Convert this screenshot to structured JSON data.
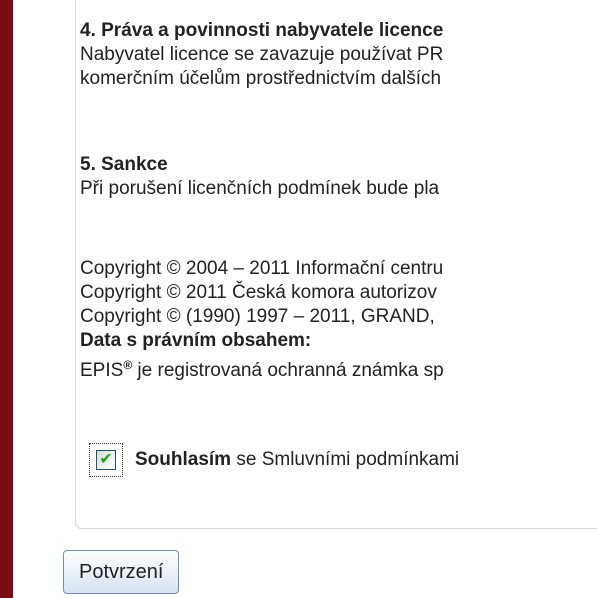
{
  "license": {
    "section4": {
      "heading": "4. Práva a povinnosti nabyvatele licence",
      "lines": [
        "Nabyvatel licence se zavazuje používat PR",
        "komerčním účelům prostřednictvím dalších"
      ]
    },
    "section5": {
      "heading": "5. Sankce",
      "lines": [
        "Při porušení licenčních podmínek bude pla"
      ]
    },
    "copyright": {
      "lines": [
        "Copyright © 2004 – 2011 Informační centru",
        "Copyright © 2011 Česká komora autorizov",
        "Copyright © (1990) 1997 – 2011, GRAND,"
      ],
      "data_heading": "Data s právním obsahem:",
      "epis_name": "EPIS",
      "epis_mark": "®",
      "epis_rest": " je registrovaná ochranná známka sp"
    }
  },
  "agreement": {
    "checked": true,
    "check_glyph": "✔",
    "bold_text": "Souhlasím",
    "rest_text": " se Smluvními podmínkami"
  },
  "actions": {
    "confirm_label": "Potvrzení"
  }
}
